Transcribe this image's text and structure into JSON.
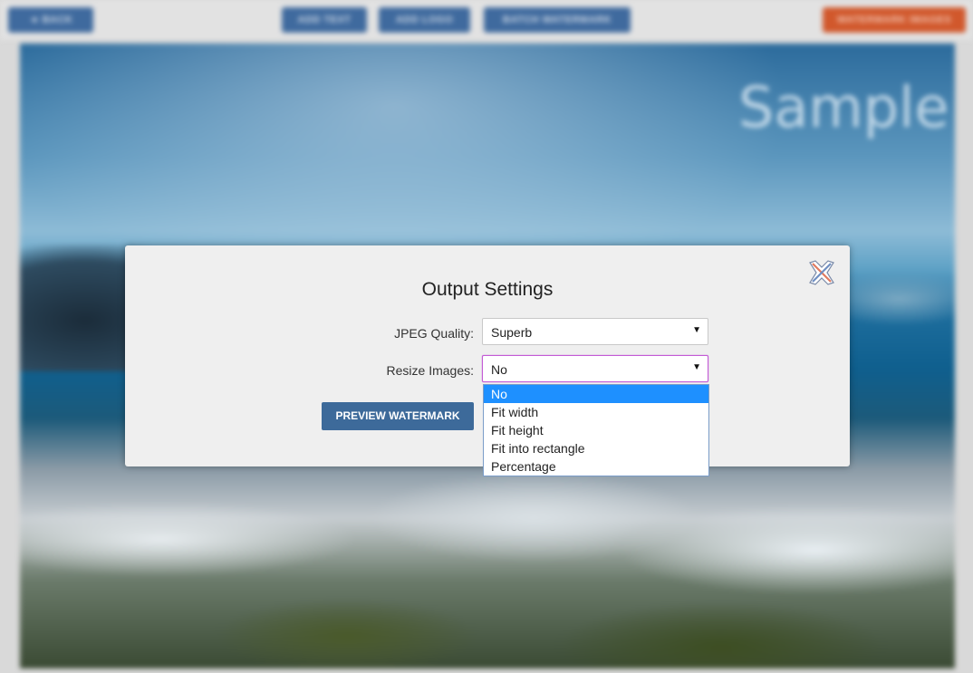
{
  "topbar": {
    "back_label": "◄ BACK",
    "btn1_label": "ADD TEXT",
    "btn2_label": "ADD LOGO",
    "btn3_label": "BATCH WATERMARK",
    "accent_label": "WATERMARK IMAGES"
  },
  "background": {
    "watermark_text": "Sample"
  },
  "modal": {
    "title": "Output Settings",
    "jpeg_quality": {
      "label": "JPEG Quality:",
      "value": "Superb"
    },
    "resize_images": {
      "label": "Resize Images:",
      "value": "No",
      "options": [
        "No",
        "Fit width",
        "Fit height",
        "Fit into rectangle",
        "Percentage"
      ],
      "selected_index": 0
    },
    "preview_button": "PREVIEW WATERMARK",
    "close_icon": "close-x-icon"
  },
  "colors": {
    "primary_button": "#3d6a9a",
    "accent_button": "#d1582c",
    "focus_border": "#c35bd6",
    "option_highlight": "#1e90ff"
  }
}
